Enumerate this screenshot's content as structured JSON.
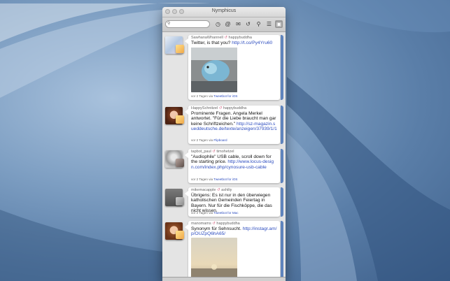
{
  "window": {
    "title": "Nymphicus"
  },
  "toolbar": {
    "search_placeholder": "",
    "icons": [
      "clock-icon",
      "at-icon",
      "mail-icon",
      "retweet-icon",
      "search-icon",
      "lists-icon",
      "trash-icon"
    ]
  },
  "colors": {
    "accent": "#5f84bd",
    "link": "#2c4cbf",
    "retweet": "#d4607f"
  },
  "tweets": [
    {
      "user": "SawhanaWhannell",
      "retweeter": "happybuddha",
      "text_before_link": "Twitter, is that you? ",
      "link": "http://t.co/Py4Yru60",
      "footer_prefix": "vor 2 Tagen via ",
      "client": "Tweetbot for iOS"
    },
    {
      "user": "HappySchnitzel",
      "retweeter": "happybuddha",
      "text_before_link": "Prominente Fragen. Angela Merkel antwortet. \"Für die Liebe braucht man gar keine Schriftzeichen.\" ",
      "link": "http://sz-magazin.sueddeutsche.de/texte/anzeigen/37939/1/1",
      "footer_prefix": "vor 2 Tagen via ",
      "client": "Flipboard"
    },
    {
      "user": "tapbot_paul",
      "retweeter": "timohetzel",
      "text_before_link": "\"Audiophile\" USB cable, scroll down for the starting price.",
      "link": "http://www.locus-design.com/index.php/cynosure-usb-cable",
      "footer_prefix": "vor 2 Tagen via ",
      "client": "Tweetbot for iOS"
    },
    {
      "user": "mikemacapple",
      "retweeter": "ashiliy",
      "text_before_link": "Übrigens: Es ist nur in den überwiegen katholischen Gemeinden Feiertag in Bayern. Nur für die Fischköppe, die das nicht wissen.",
      "link": "",
      "footer_prefix": "vor 2 Tagen via ",
      "client": "Tweetbot for Mac"
    },
    {
      "user": "manomams",
      "retweeter": "happybuddha",
      "text_before_link": "Synonym für Sehnsucht. ",
      "link": "http://instagr.am/p/OUZpQ6hA65/",
      "footer_prefix": "",
      "client": ""
    }
  ]
}
